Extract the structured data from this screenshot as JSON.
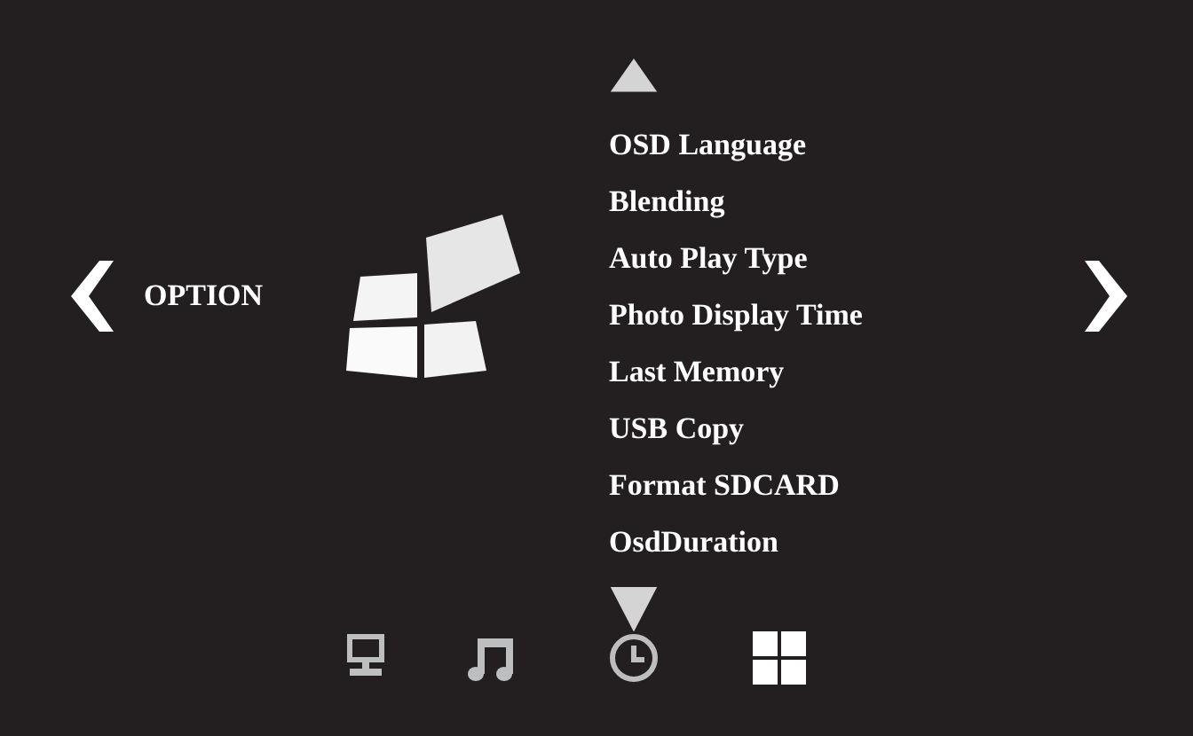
{
  "category": {
    "title": "OPTION"
  },
  "menu": {
    "items": [
      {
        "label": "OSD Language"
      },
      {
        "label": "Blending"
      },
      {
        "label": "Auto Play Type"
      },
      {
        "label": "Photo Display Time"
      },
      {
        "label": "Last Memory"
      },
      {
        "label": "USB Copy"
      },
      {
        "label": "Format SDCARD"
      },
      {
        "label": "OsdDuration"
      }
    ]
  },
  "bottom_bar": [
    {
      "kind": "monitor",
      "selected": false
    },
    {
      "kind": "music",
      "selected": false
    },
    {
      "kind": "clock",
      "selected": false
    },
    {
      "kind": "grid",
      "selected": true
    }
  ]
}
